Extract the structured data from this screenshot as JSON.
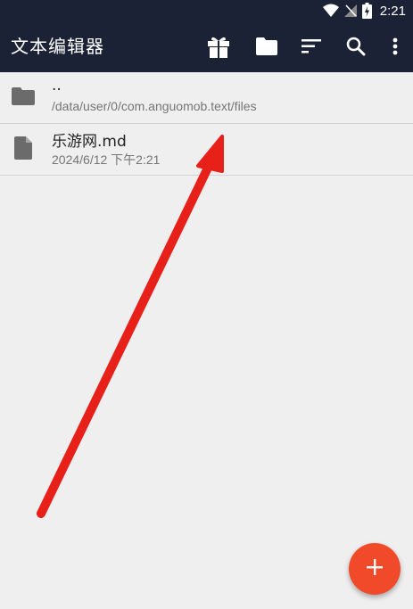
{
  "status_bar": {
    "time": "2:21",
    "icons": [
      "wifi-icon",
      "signal-off-icon",
      "battery-charging-icon"
    ]
  },
  "toolbar": {
    "title": "文本编辑器",
    "actions": [
      "gift-icon",
      "folder-icon",
      "sort-icon",
      "search-icon",
      "more-vert-icon"
    ]
  },
  "file_list": [
    {
      "name": "..",
      "detail": "/data/user/0/com.anguomob.text/files",
      "icon": "folder-icon"
    },
    {
      "name": "乐游网.md",
      "detail": "2024/6/12 下午2:21",
      "icon": "file-icon"
    }
  ],
  "fab": {
    "icon": "add-icon"
  },
  "colors": {
    "toolbar": "#1c2236",
    "background": "#efefef",
    "accent": "#f04a2b",
    "annotation_arrow": "#e8201a"
  }
}
